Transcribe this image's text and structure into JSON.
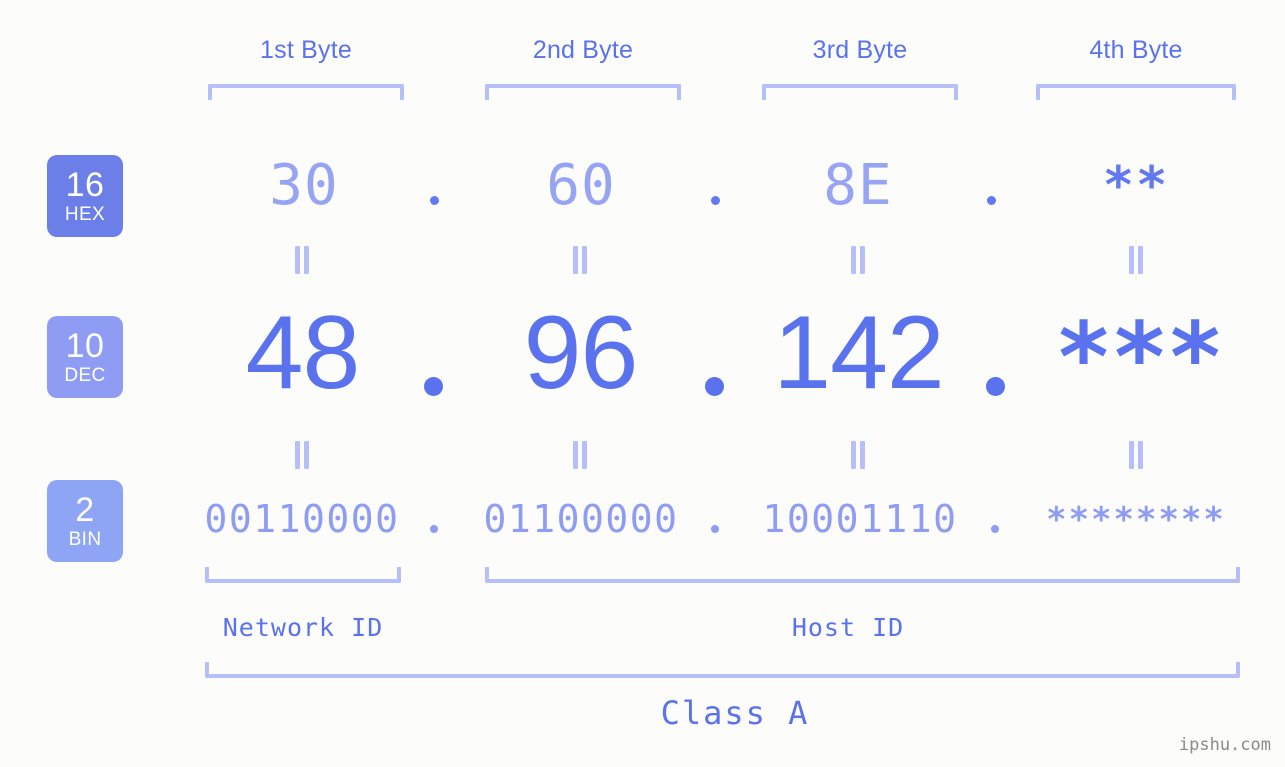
{
  "background_color": "#fcfdfa",
  "accent_colors": {
    "strong_blue": "#5a72ee",
    "mid_blue": "#6379ef",
    "light_periwinkle": "#97a4f4",
    "bin_blue": "#8e9cf3",
    "bracket": "#b6bffa",
    "badge_hex": "#6c7fe8",
    "badge_dec": "#8e9cf3",
    "badge_bin": "#8ea4f5",
    "watermark": "#8a8a8a"
  },
  "byte_headers": [
    {
      "label": "1st Byte"
    },
    {
      "label": "2nd Byte"
    },
    {
      "label": "3rd Byte"
    },
    {
      "label": "4th Byte"
    }
  ],
  "rows": [
    {
      "key": "hex",
      "badge": {
        "number": "16",
        "name": "HEX"
      },
      "values": [
        "30",
        "60",
        "8E",
        "**"
      ],
      "separator": "."
    },
    {
      "key": "dec",
      "badge": {
        "number": "10",
        "name": "DEC"
      },
      "values": [
        "48",
        "96",
        "142",
        "***"
      ],
      "separator": "."
    },
    {
      "key": "bin",
      "badge": {
        "number": "2",
        "name": "BIN"
      },
      "values": [
        "00110000",
        "01100000",
        "10001110",
        "********"
      ],
      "separator": "."
    }
  ],
  "connector_symbol": "=",
  "segments": [
    {
      "label": "Network ID"
    },
    {
      "label": "Host ID"
    }
  ],
  "class_label": "Class A",
  "watermark": "ipshu.com"
}
